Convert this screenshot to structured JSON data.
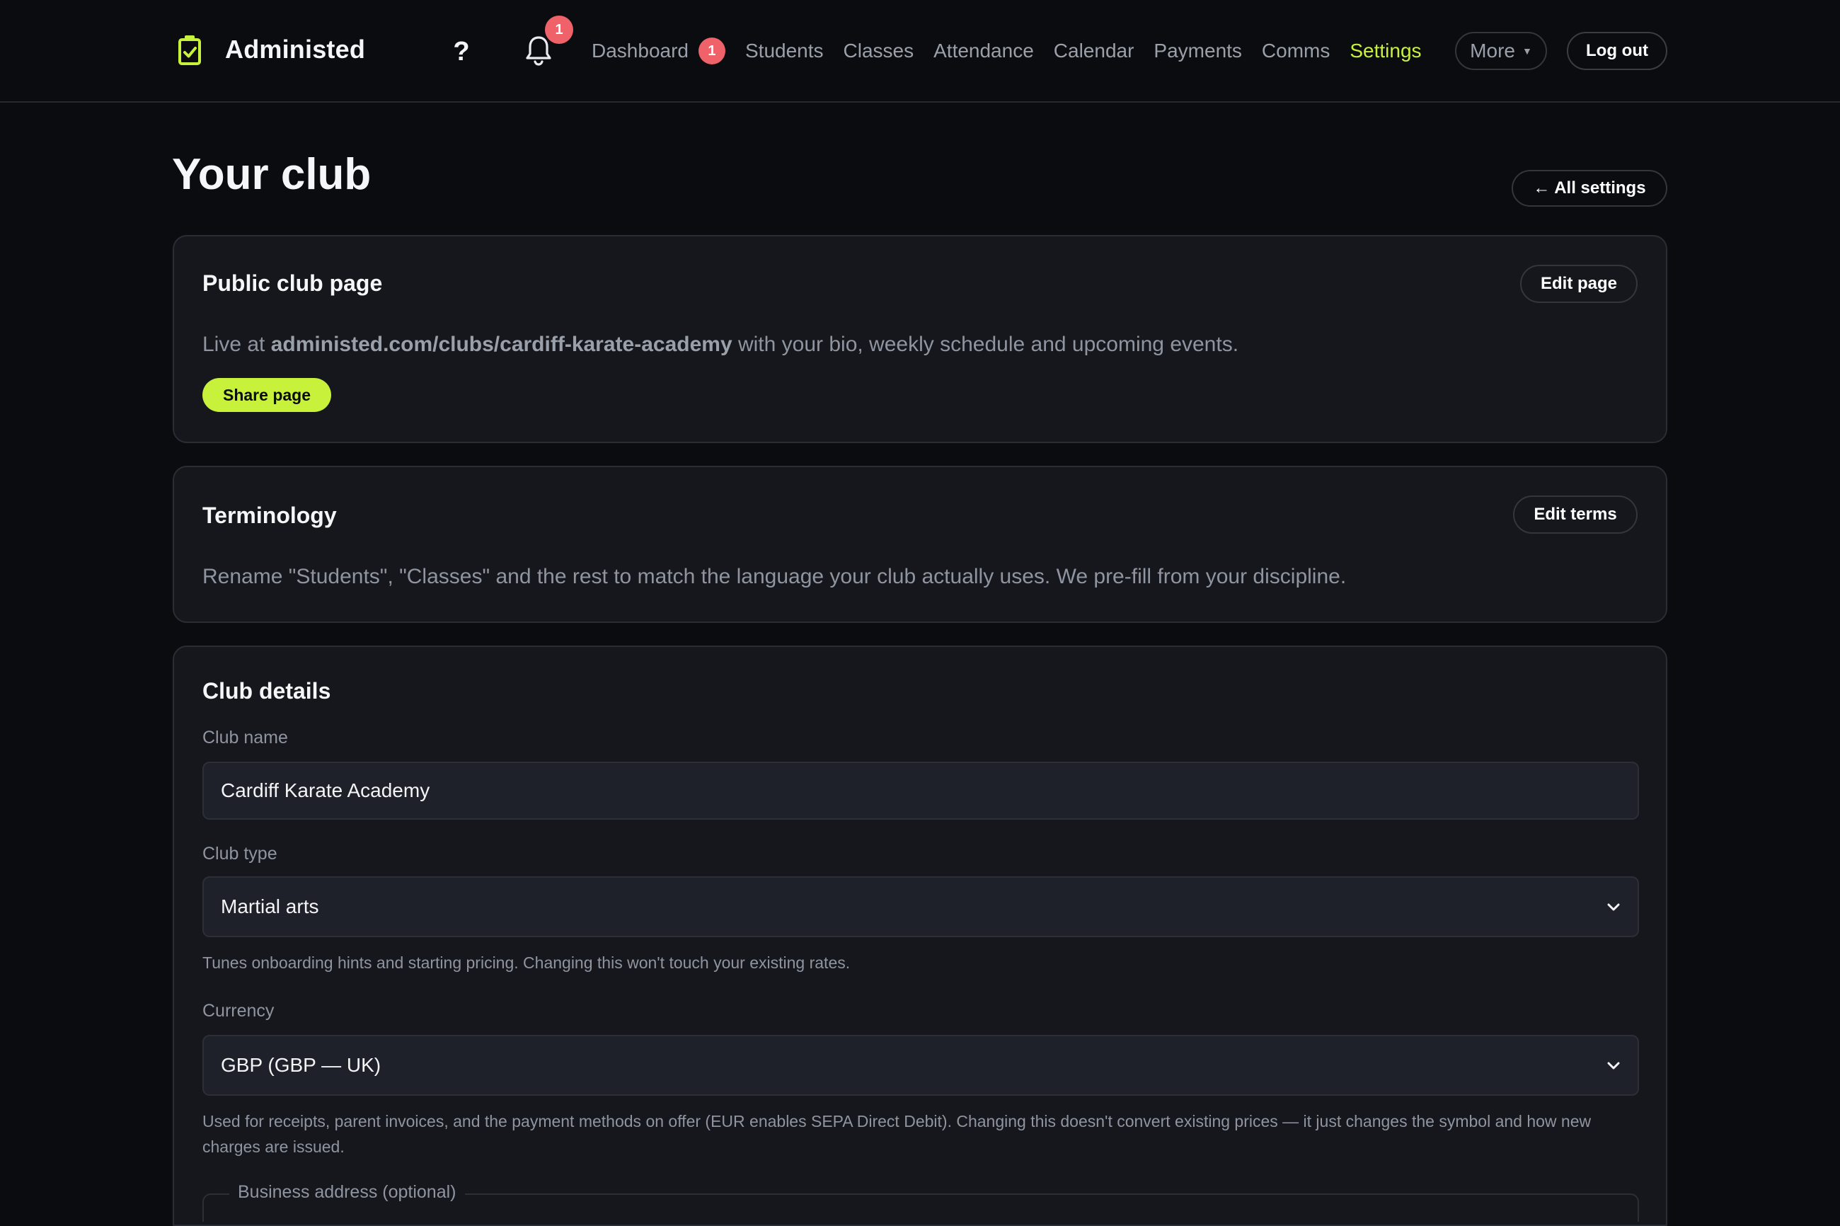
{
  "brand": {
    "name": "Administed"
  },
  "header": {
    "help_label": "?",
    "notifications_count": "1",
    "nav": [
      {
        "label": "Dashboard",
        "badge": "1",
        "active": false
      },
      {
        "label": "Students",
        "active": false
      },
      {
        "label": "Classes",
        "active": false
      },
      {
        "label": "Attendance",
        "active": false
      },
      {
        "label": "Calendar",
        "active": false
      },
      {
        "label": "Payments",
        "active": false
      },
      {
        "label": "Comms",
        "active": false
      },
      {
        "label": "Settings",
        "active": true
      }
    ],
    "more_label": "More",
    "logout_label": "Log out"
  },
  "page": {
    "title": "Your club",
    "back_label": "← All settings"
  },
  "public_page": {
    "title": "Public club page",
    "edit_label": "Edit page",
    "text_prefix": "Live at ",
    "url": "administed.com/clubs/cardiff-karate-academy",
    "text_suffix": " with your bio, weekly schedule and upcoming events.",
    "share_label": "Share page"
  },
  "terminology": {
    "title": "Terminology",
    "edit_label": "Edit terms",
    "description": "Rename \"Students\", \"Classes\" and the rest to match the language your club actually uses. We pre-fill from your discipline."
  },
  "club_details": {
    "title": "Club details",
    "club_name": {
      "label": "Club name",
      "value": "Cardiff Karate Academy"
    },
    "club_type": {
      "label": "Club type",
      "value": "Martial arts",
      "help": "Tunes onboarding hints and starting pricing. Changing this won't touch your existing rates."
    },
    "currency": {
      "label": "Currency",
      "value": "GBP (GBP — UK)",
      "help": "Used for receipts, parent invoices, and the payment methods on offer (EUR enables SEPA Direct Debit). Changing this doesn't convert existing prices — it just changes the symbol and how new charges are issued."
    },
    "business_address": {
      "legend": "Business address (optional)"
    }
  },
  "colors": {
    "accent": "#c8f13b",
    "badge": "#f0626a",
    "background": "#0b0c10",
    "card": "#15171c",
    "input": "#1e2129"
  },
  "icons": {
    "logo": "checkbox-logo-icon",
    "help": "question-mark-icon",
    "notifications": "bell-icon",
    "more_caret": "caret-down-icon",
    "select_chevron": "chevron-down-icon"
  }
}
